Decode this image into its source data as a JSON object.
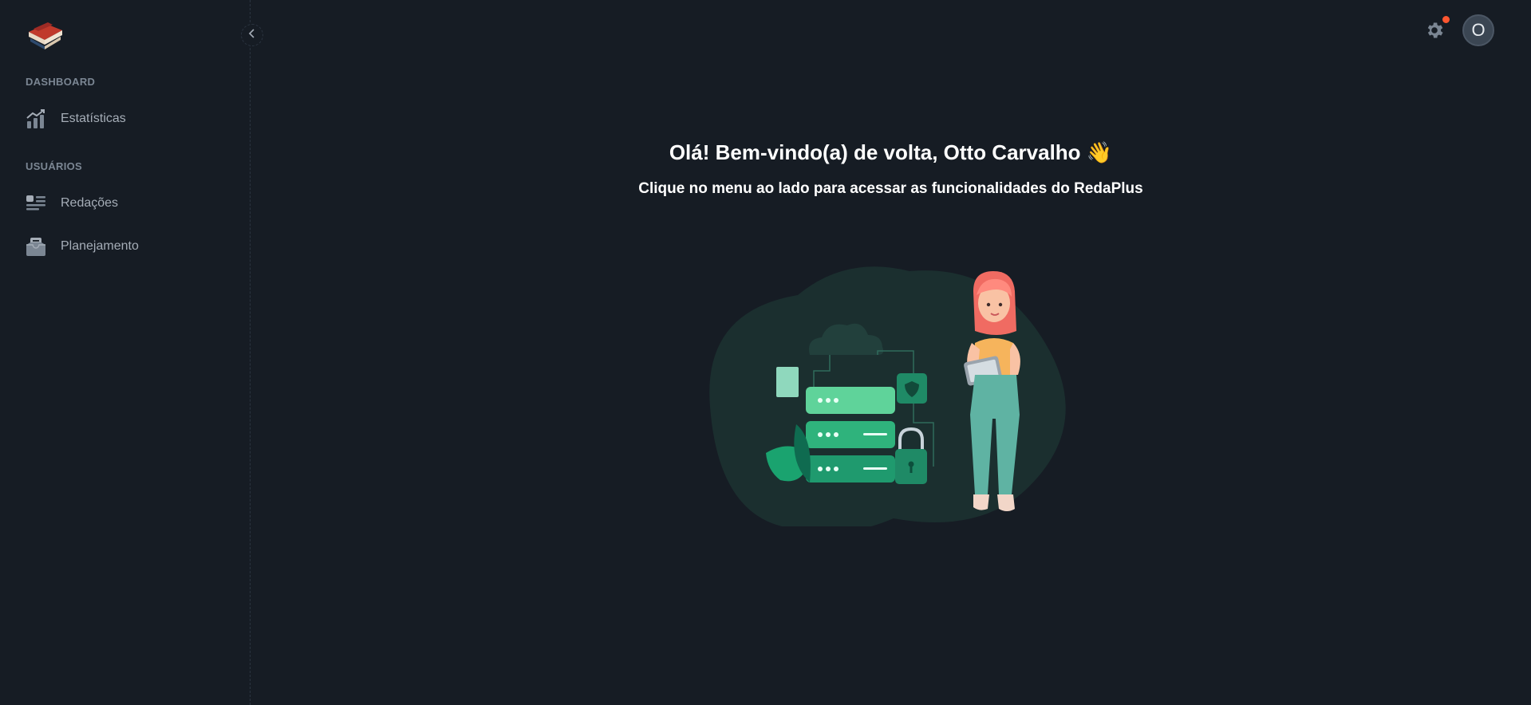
{
  "sidebar": {
    "sections": [
      {
        "title": "DASHBOARD",
        "items": [
          {
            "label": "Estatísticas",
            "icon": "chart-icon"
          }
        ]
      },
      {
        "title": "USUÁRIOS",
        "items": [
          {
            "label": "Redações",
            "icon": "document-list-icon"
          },
          {
            "label": "Planejamento",
            "icon": "inbox-icon"
          }
        ]
      }
    ]
  },
  "header": {
    "avatar_initial": "O",
    "notification_dot_color": "#ff5630"
  },
  "main": {
    "title": "Olá! Bem-vindo(a) de volta, Otto Carvalho 👋",
    "subtitle": "Clique no menu ao lado para acessar as funcionalidades do RedaPlus"
  },
  "colors": {
    "background": "#161c24",
    "accent": "#2fbf85",
    "muted_text": "#a5adb7",
    "section_title": "#7b8693"
  }
}
